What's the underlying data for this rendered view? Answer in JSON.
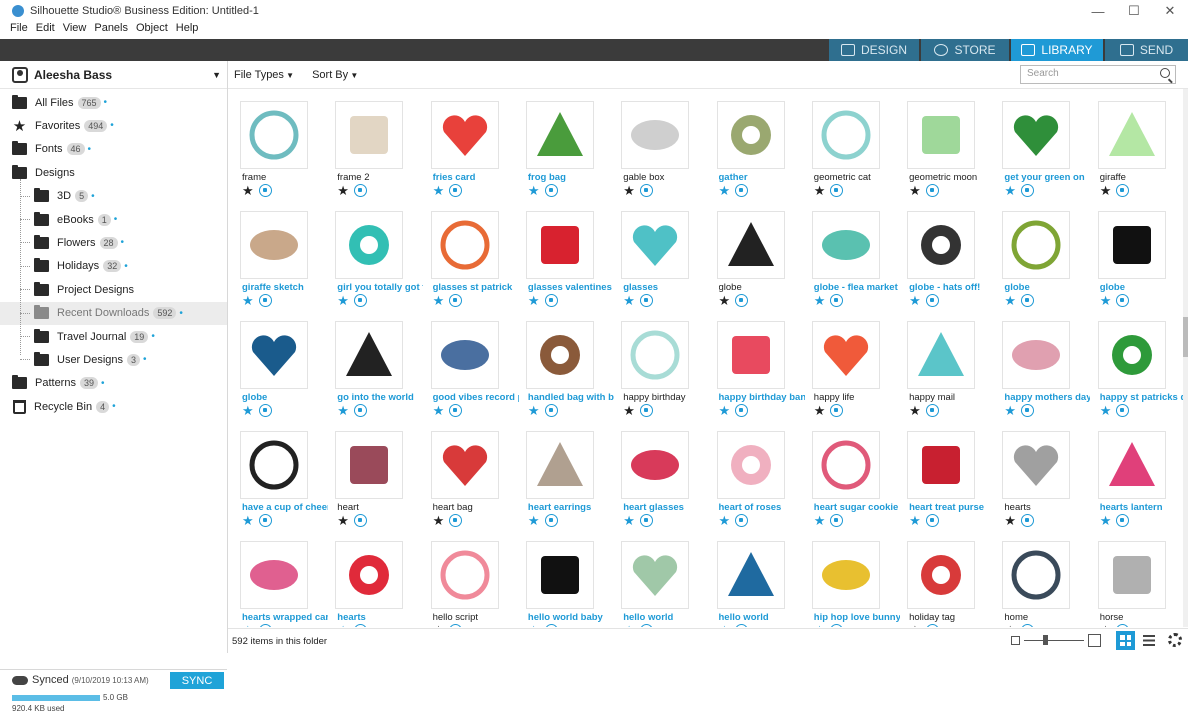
{
  "window": {
    "title": "Silhouette Studio® Business Edition: Untitled-1",
    "min": "—",
    "max": "☐",
    "close": "✕"
  },
  "menu": [
    "File",
    "Edit",
    "View",
    "Panels",
    "Object",
    "Help"
  ],
  "tabs": [
    {
      "label": "DESIGN",
      "icon": "design-icon",
      "active": false
    },
    {
      "label": "STORE",
      "icon": "store-icon",
      "active": false
    },
    {
      "label": "LIBRARY",
      "icon": "library-icon",
      "active": true
    },
    {
      "label": "SEND",
      "icon": "send-icon",
      "active": false
    }
  ],
  "user": {
    "name": "Aleesha Bass"
  },
  "tree": [
    {
      "label": "All Files",
      "count": "765",
      "level": 0,
      "icon": "folder-icon"
    },
    {
      "label": "Favorites",
      "count": "494",
      "level": 0,
      "icon": "star-icon"
    },
    {
      "label": "Fonts",
      "count": "46",
      "level": 0,
      "icon": "folder-icon"
    },
    {
      "label": "Designs",
      "count": "",
      "level": 0,
      "icon": "folder-minus-icon"
    },
    {
      "label": "3D",
      "count": "5",
      "level": 1,
      "icon": "folder-icon"
    },
    {
      "label": "eBooks",
      "count": "1",
      "level": 1,
      "icon": "folder-icon"
    },
    {
      "label": "Flowers",
      "count": "28",
      "level": 1,
      "icon": "folder-icon"
    },
    {
      "label": "Holidays",
      "count": "32",
      "level": 1,
      "icon": "folder-icon"
    },
    {
      "label": "Project Designs",
      "count": "",
      "level": 1,
      "icon": "folder-icon"
    },
    {
      "label": "Recent Downloads",
      "count": "592",
      "level": 1,
      "icon": "folder-icon",
      "selected": true
    },
    {
      "label": "Travel Journal",
      "count": "19",
      "level": 1,
      "icon": "folder-icon"
    },
    {
      "label": "User Designs",
      "count": "3",
      "level": 1,
      "icon": "folder-icon"
    },
    {
      "label": "Patterns",
      "count": "39",
      "level": 0,
      "icon": "folder-icon"
    },
    {
      "label": "Recycle Bin",
      "count": "4",
      "level": 0,
      "icon": "trash-icon"
    }
  ],
  "sync": {
    "label": "Synced",
    "date": "(9/10/2019 10:13 AM)",
    "button": "SYNC",
    "total": "5.0 GB",
    "used": "920.4 KB used",
    "used_fraction": 0.0002
  },
  "toolbar": {
    "file_types": "File Types",
    "sort_by": "Sort By",
    "search_placeholder": "Search"
  },
  "items": [
    {
      "name": "frame",
      "fav": false,
      "shade": "#6fbcc0"
    },
    {
      "name": "frame 2",
      "fav": false,
      "shade": "#e2d6c4"
    },
    {
      "name": "fries card",
      "fav": true,
      "shade": "#e8413b"
    },
    {
      "name": "frog bag",
      "fav": true,
      "shade": "#4a9c3c"
    },
    {
      "name": "gable box",
      "fav": false,
      "shade": "#cfcfcf"
    },
    {
      "name": "gather",
      "fav": true,
      "shade": "#9aa870"
    },
    {
      "name": "geometric cat",
      "fav": false,
      "shade": "#8dd2cf"
    },
    {
      "name": "geometric moon",
      "fav": false,
      "shade": "#9fd89a"
    },
    {
      "name": "get your green on",
      "fav": true,
      "shade": "#2f8f3a"
    },
    {
      "name": "giraffe",
      "fav": false,
      "shade": "#b4e7a4"
    },
    {
      "name": "giraffe sketch",
      "fav": true,
      "shade": "#c9a88a"
    },
    {
      "name": "girl you totally got this",
      "fav": true,
      "shade": "#32bfb4"
    },
    {
      "name": "glasses st patrick",
      "fav": true,
      "shade": "#e86b36"
    },
    {
      "name": "glasses valentines",
      "fav": true,
      "shade": "#d8222f"
    },
    {
      "name": "glasses",
      "fav": true,
      "shade": "#4fc1c6"
    },
    {
      "name": "globe",
      "fav": false,
      "shade": "#222222"
    },
    {
      "name": "globe - flea market",
      "fav": true,
      "shade": "#5ac1b0"
    },
    {
      "name": "globe - hats off!",
      "fav": true,
      "shade": "#333333"
    },
    {
      "name": "globe",
      "fav": true,
      "shade": "#7fa535"
    },
    {
      "name": "globe",
      "fav": true,
      "shade": "#111111"
    },
    {
      "name": "globe",
      "fav": true,
      "shade": "#1a5b8c"
    },
    {
      "name": "go into the world",
      "fav": true,
      "shade": "#222222"
    },
    {
      "name": "good vibes record player",
      "fav": true,
      "shade": "#4a6fa0"
    },
    {
      "name": "handled bag with bow",
      "fav": true,
      "shade": "#8a5a3a"
    },
    {
      "name": "happy birthday",
      "fav": false,
      "shade": "#a8dcd6"
    },
    {
      "name": "happy birthday banner",
      "fav": true,
      "shade": "#e84a5f"
    },
    {
      "name": "happy life",
      "fav": false,
      "shade": "#f05a3a"
    },
    {
      "name": "happy mail",
      "fav": false,
      "shade": "#5bc5c9"
    },
    {
      "name": "happy mothers day",
      "fav": true,
      "shade": "#e0a0b0"
    },
    {
      "name": "happy st patricks day",
      "fav": true,
      "shade": "#2e9a3a"
    },
    {
      "name": "have a cup of cheer",
      "fav": true,
      "shade": "#222222"
    },
    {
      "name": "heart",
      "fav": false,
      "shade": "#9a4a5a"
    },
    {
      "name": "heart bag",
      "fav": false,
      "shade": "#d83a3a"
    },
    {
      "name": "heart earrings",
      "fav": true,
      "shade": "#b0a090"
    },
    {
      "name": "heart glasses",
      "fav": true,
      "shade": "#d83a5a"
    },
    {
      "name": "heart of roses",
      "fav": true,
      "shade": "#f0b0c0"
    },
    {
      "name": "heart sugar cookie box",
      "fav": true,
      "shade": "#e05a7a"
    },
    {
      "name": "heart treat purse",
      "fav": true,
      "shade": "#c82030"
    },
    {
      "name": "hearts",
      "fav": false,
      "shade": "#a0a0a0"
    },
    {
      "name": "hearts lantern",
      "fav": true,
      "shade": "#e0407a"
    },
    {
      "name": "hearts wrapped candy",
      "fav": true,
      "shade": "#e06090"
    },
    {
      "name": "hearts",
      "fav": true,
      "shade": "#e02a3a"
    },
    {
      "name": "hello script",
      "fav": false,
      "shade": "#f08a9a"
    },
    {
      "name": "hello world baby",
      "fav": true,
      "shade": "#111111"
    },
    {
      "name": "hello world",
      "fav": true,
      "shade": "#a0c8a8"
    },
    {
      "name": "hello world",
      "fav": true,
      "shade": "#1f6aa0"
    },
    {
      "name": "hip hop love bunny",
      "fav": true,
      "shade": "#e8c030"
    },
    {
      "name": "holiday tag",
      "fav": false,
      "shade": "#d83a3a"
    },
    {
      "name": "home",
      "fav": false,
      "shade": "#3a4a5a"
    },
    {
      "name": "horse",
      "fav": false,
      "shade": "#b0b0b0"
    }
  ],
  "status": {
    "count_text": "592 items in this folder"
  },
  "colors": {
    "accent": "#1e9ad6",
    "tabbar": "#3b3b3b",
    "tab": "#2f6f8f"
  }
}
